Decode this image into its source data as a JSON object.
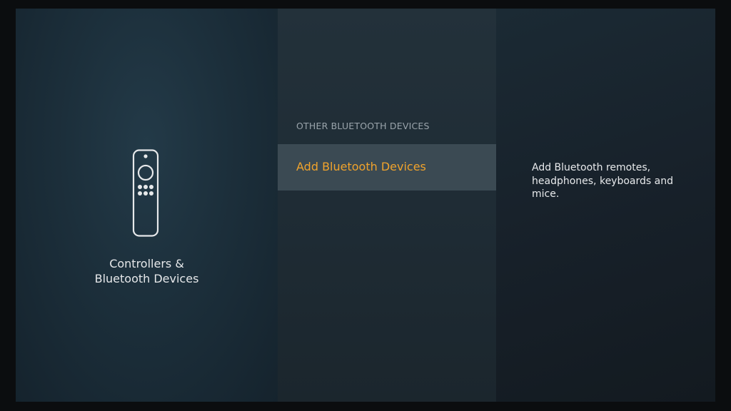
{
  "left_panel": {
    "icon": "fire-tv-remote-icon",
    "category_title": "Controllers &\nBluetooth Devices"
  },
  "middle_panel": {
    "section_header": "OTHER BLUETOOTH DEVICES",
    "items": [
      {
        "label": "Add Bluetooth Devices",
        "selected": true
      }
    ]
  },
  "right_panel": {
    "description": "Add Bluetooth remotes, headphones, keyboards and mice."
  },
  "colors": {
    "accent": "#f0a32c",
    "selected_bg": "#3b4a53"
  }
}
